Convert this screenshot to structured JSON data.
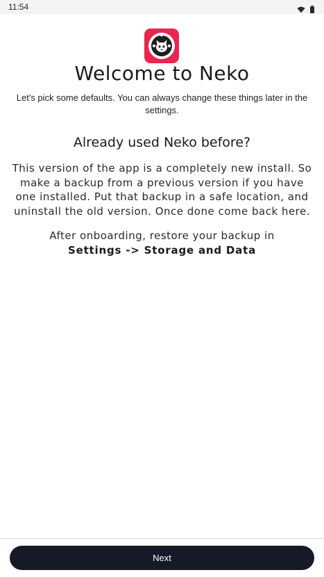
{
  "status_bar": {
    "time": "11:54",
    "icons": [
      "wifi-icon",
      "battery-icon"
    ]
  },
  "logo": {
    "icon": "neko-app-logo",
    "background_color": "#e8264f"
  },
  "welcome": {
    "title": "Welcome to Neko",
    "subtitle": "Let's pick some defaults. You can always change these things later in the settings."
  },
  "section": {
    "title": "Already used Neko before?",
    "body": "This version of the app is a completely new install. So make a backup from a previous version if you have one installed. Put that backup in a safe location, and uninstall the old version. Once done come back here.",
    "after_text": "After onboarding, restore your backup in",
    "settings_path": "Settings -> Storage and Data"
  },
  "footer": {
    "next_label": "Next",
    "button_color": "#151a26"
  }
}
